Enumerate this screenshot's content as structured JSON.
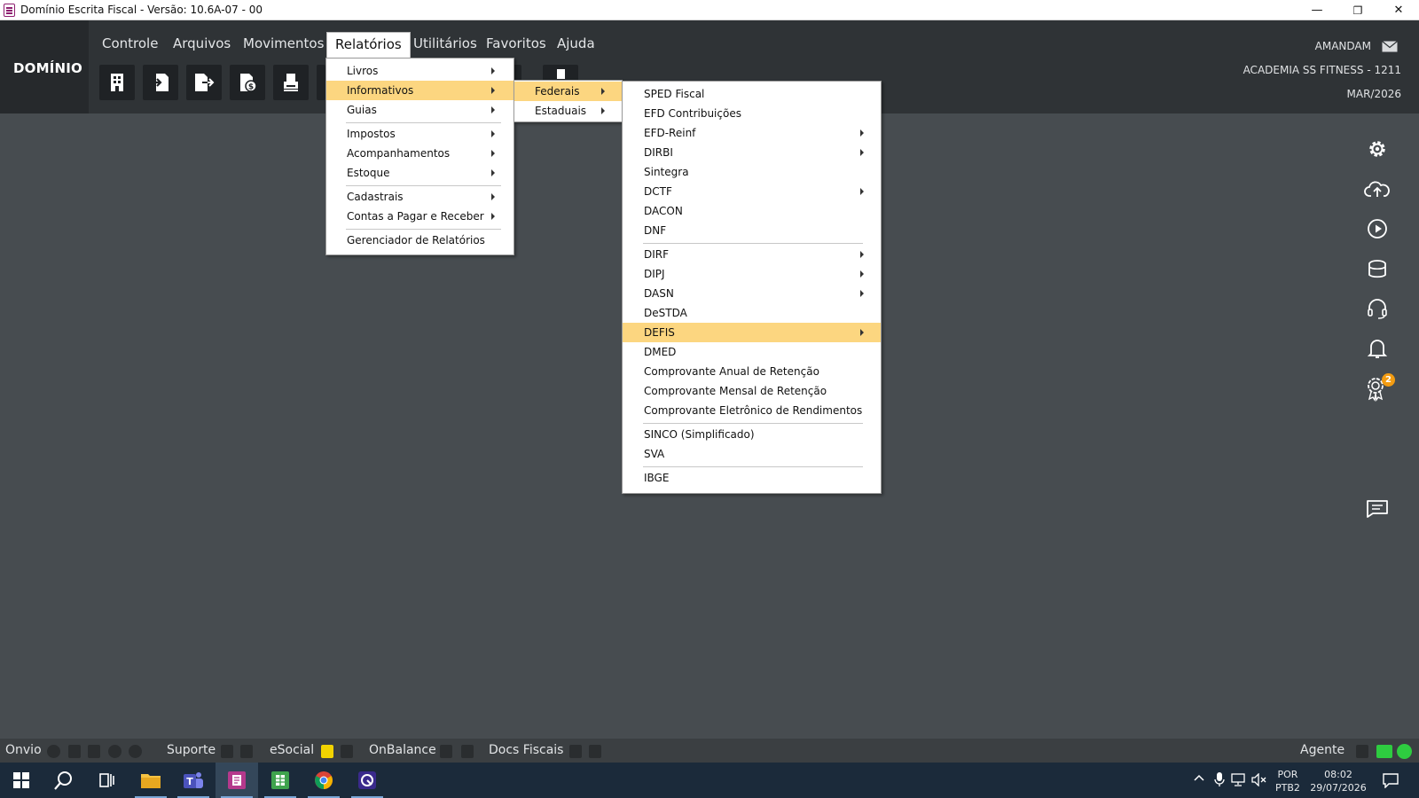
{
  "window": {
    "title": "Domínio Escrita Fiscal  - Versão: 10.6A-07 - 00",
    "minimize_glyph": "—",
    "maximize_glyph": "❐",
    "close_glyph": "✕"
  },
  "brand": {
    "name": "DOMÍNIO"
  },
  "menubar": {
    "items": [
      {
        "label": "Controle"
      },
      {
        "label": "Arquivos"
      },
      {
        "label": "Movimentos"
      },
      {
        "label": "Relatórios"
      },
      {
        "label": "Utilitários"
      },
      {
        "label": "Favoritos"
      },
      {
        "label": "Ajuda"
      }
    ]
  },
  "user": {
    "name": "AMANDAM",
    "company": "ACADEMIA SS FITNESS  - 1211",
    "period": "MAR/2026"
  },
  "relatorios_menu": {
    "items": [
      {
        "label": "Livros"
      },
      {
        "label": "Informativos"
      },
      {
        "label": "Guias"
      },
      {
        "label": "Impostos"
      },
      {
        "label": "Acompanhamentos"
      },
      {
        "label": "Estoque"
      },
      {
        "label": "Cadastrais"
      },
      {
        "label": "Contas a Pagar e Receber"
      },
      {
        "label": "Gerenciador de Relatórios"
      }
    ]
  },
  "informativos_menu": {
    "items": [
      {
        "label": "Federais"
      },
      {
        "label": "Estaduais"
      }
    ]
  },
  "federais_menu": {
    "items": [
      {
        "label": "SPED Fiscal"
      },
      {
        "label": "EFD Contribuições"
      },
      {
        "label": "EFD-Reinf"
      },
      {
        "label": "DIRBI"
      },
      {
        "label": "Sintegra"
      },
      {
        "label": "DCTF"
      },
      {
        "label": "DACON"
      },
      {
        "label": "DNF"
      },
      {
        "label": "DIRF"
      },
      {
        "label": "DIPJ"
      },
      {
        "label": "DASN"
      },
      {
        "label": "DeSTDA"
      },
      {
        "label": "DEFIS"
      },
      {
        "label": "DMED"
      },
      {
        "label": "Comprovante Anual de Retenção"
      },
      {
        "label": "Comprovante Mensal de Retenção"
      },
      {
        "label": "Comprovante Eletrônico de Rendimentos"
      },
      {
        "label": "SINCO (Simplificado)"
      },
      {
        "label": "SVA"
      },
      {
        "label": "IBGE"
      }
    ]
  },
  "sidebar": {
    "notification_badge": "2"
  },
  "statusbar": {
    "onvio": "Onvio",
    "suporte": "Suporte",
    "esocial": "eSocial",
    "onbalance": "OnBalance",
    "docs_fiscais": "Docs Fiscais",
    "agente": "Agente"
  },
  "taskbar": {
    "lang_line1": "POR",
    "lang_line2": "PTB2",
    "time": "08:02",
    "date": "29/07/2026"
  },
  "colors": {
    "highlight": "#fcd680",
    "header": "#2f3336",
    "workspace": "#474c50",
    "brand_accent": "#8d1e6f",
    "status_ok": "#2ecc40",
    "badge": "#f39c12"
  }
}
